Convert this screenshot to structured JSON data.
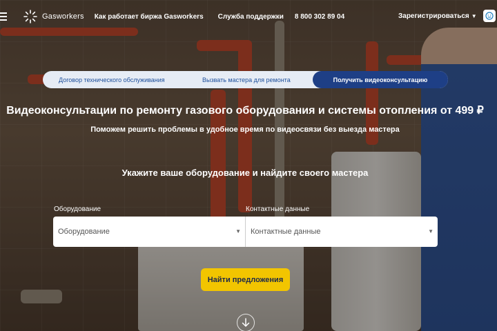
{
  "header": {
    "logo_text": "Gasworkers",
    "nav": {
      "how_it_works": "Как работает биржа Gasworkers",
      "support": "Служба поддержки",
      "phone": "8 800 302 89 04"
    },
    "register_label": "Зарегистрироваться",
    "register_caret": "▼"
  },
  "tabs": {
    "maintenance": "Договор технического обслуживания",
    "call_master": "Вызвать мастера для ремонта",
    "video_consult": "Получить видеоконсультацию"
  },
  "hero": {
    "headline": "Видеоконсультации по ремонту газового оборудования и системы отопления от 499 ₽",
    "subline": "Поможем решить проблемы в удобное время по видеосвязи без выезда мастера",
    "prompt": "Укажите ваше оборудование и найдите своего мастера"
  },
  "form": {
    "equipment_label": "Оборудование",
    "equipment_value": "Оборудование",
    "contact_label": "Контактные данные",
    "contact_value": "Контактные данные",
    "arrow": "▼"
  },
  "find_button": "Найти предложения",
  "colors": {
    "tab_active": "#1e3f86",
    "tab_bg": "#e6ecf5",
    "button": "#f2c500"
  }
}
